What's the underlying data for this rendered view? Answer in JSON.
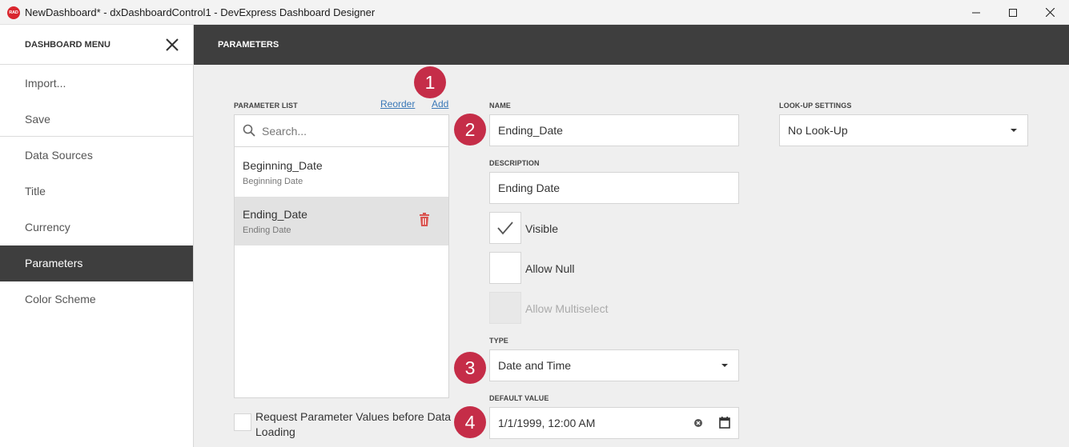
{
  "window": {
    "logo_text": "RAD",
    "title": "NewDashboard* - dxDashboardControl1 - DevExpress Dashboard Designer"
  },
  "sidebar": {
    "title": "DASHBOARD MENU",
    "items": [
      {
        "label": "Import..."
      },
      {
        "label": "Save"
      },
      {
        "label": "Data Sources"
      },
      {
        "label": "Title"
      },
      {
        "label": "Currency"
      },
      {
        "label": "Parameters",
        "active": true
      },
      {
        "label": "Color Scheme"
      }
    ]
  },
  "main": {
    "title": "PARAMETERS",
    "parameter_list": {
      "label": "PARAMETER LIST",
      "reorder_label": "Reorder",
      "add_label": "Add",
      "search_placeholder": "Search...",
      "items": [
        {
          "name": "Beginning_Date",
          "description": "Beginning Date",
          "selected": false
        },
        {
          "name": "Ending_Date",
          "description": "Ending Date",
          "selected": true
        }
      ]
    },
    "request_values": {
      "label": "Request Parameter Values before Data Loading",
      "checked": false
    },
    "name": {
      "label": "NAME",
      "value": "Ending_Date"
    },
    "description": {
      "label": "DESCRIPTION",
      "value": "Ending Date"
    },
    "visible": {
      "label": "Visible",
      "checked": true
    },
    "allow_null": {
      "label": "Allow Null",
      "checked": false
    },
    "allow_multiselect": {
      "label": "Allow Multiselect",
      "checked": false,
      "disabled": true
    },
    "type": {
      "label": "TYPE",
      "value": "Date and Time"
    },
    "default_value": {
      "label": "DEFAULT VALUE",
      "value": "1/1/1999, 12:00 AM"
    },
    "lookup": {
      "label": "LOOK-UP SETTINGS",
      "value": "No Look-Up"
    }
  },
  "callouts": [
    "1",
    "2",
    "3",
    "4"
  ],
  "colors": {
    "dark_header": "#3e3e3e",
    "panel_bg": "#efefef",
    "link": "#3a78b7",
    "callout": "#c52d48",
    "delete": "#d9534f"
  }
}
